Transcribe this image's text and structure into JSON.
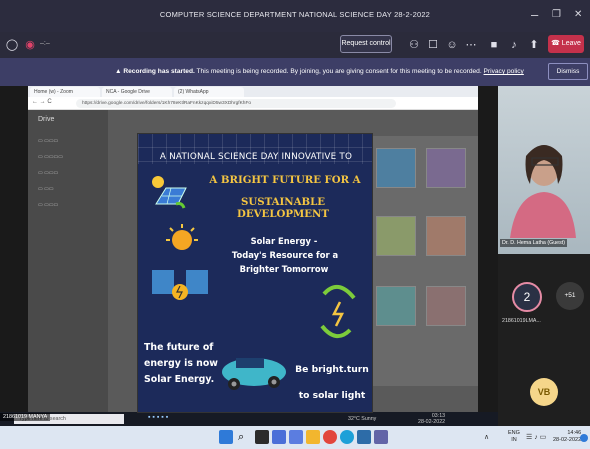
{
  "window": {
    "title": "COMPUTER SCIENCE DEPARTMENT NATIONAL SCIENCE DAY 28-2-2022",
    "minimize": "–",
    "maximize": "❐",
    "close": "✕"
  },
  "toolbar": {
    "timer": "–:–",
    "request_control": "Request control",
    "leave": "Leave"
  },
  "banner": {
    "bold": "Recording has started.",
    "text": " This meeting is being recorded. By joining, you are giving consent for this meeting to be recorded.",
    "link": "Privacy policy",
    "dismiss": "Dismiss"
  },
  "browser": {
    "tabs": [
      "Home (w) - Zoom",
      "NCA - Google Drive",
      "(2) WhatsApp"
    ],
    "url": "https://drive.google.com/drive/folders/1Kh78eKtlRaFnKkzqqxiD5w3XDhrgfKhFo",
    "drive_title": "Drive"
  },
  "poster": {
    "header": "A NATIONAL SCIENCE DAY INNOVATIVE TO",
    "headline_1": "A BRIGHT FUTURE FOR A",
    "headline_2": "SUSTAINABLE DEVELOPMENT",
    "solar_1": "Solar Energy -",
    "solar_2": "Today's Resource for a",
    "solar_3": "Brighter Tomorrow",
    "future_1": "The future of",
    "future_2": "energy is now",
    "future_3": "Solar Energy.",
    "bright_1": "Be bright.turn",
    "bright_2": "to solar light",
    "colors": {
      "bg": "#1c2a5a",
      "headline": "#f4c542"
    }
  },
  "participants": {
    "presenter": "Dr. D. Hema Latha (Guest)",
    "avatar_2_letter": "2",
    "avatar_2_label": "21861019LMA...",
    "more": "+51",
    "vb": "VB"
  },
  "inner_taskbar": {
    "share_label": "21861019 MANYA",
    "search": "Type here to search",
    "weather": "32°C Sunny",
    "time": "03:13",
    "date": "28-02-2022"
  },
  "taskbar": {
    "lang": "ENG",
    "lang2": "IN",
    "time": "14:46",
    "date": "28-02-2022"
  }
}
